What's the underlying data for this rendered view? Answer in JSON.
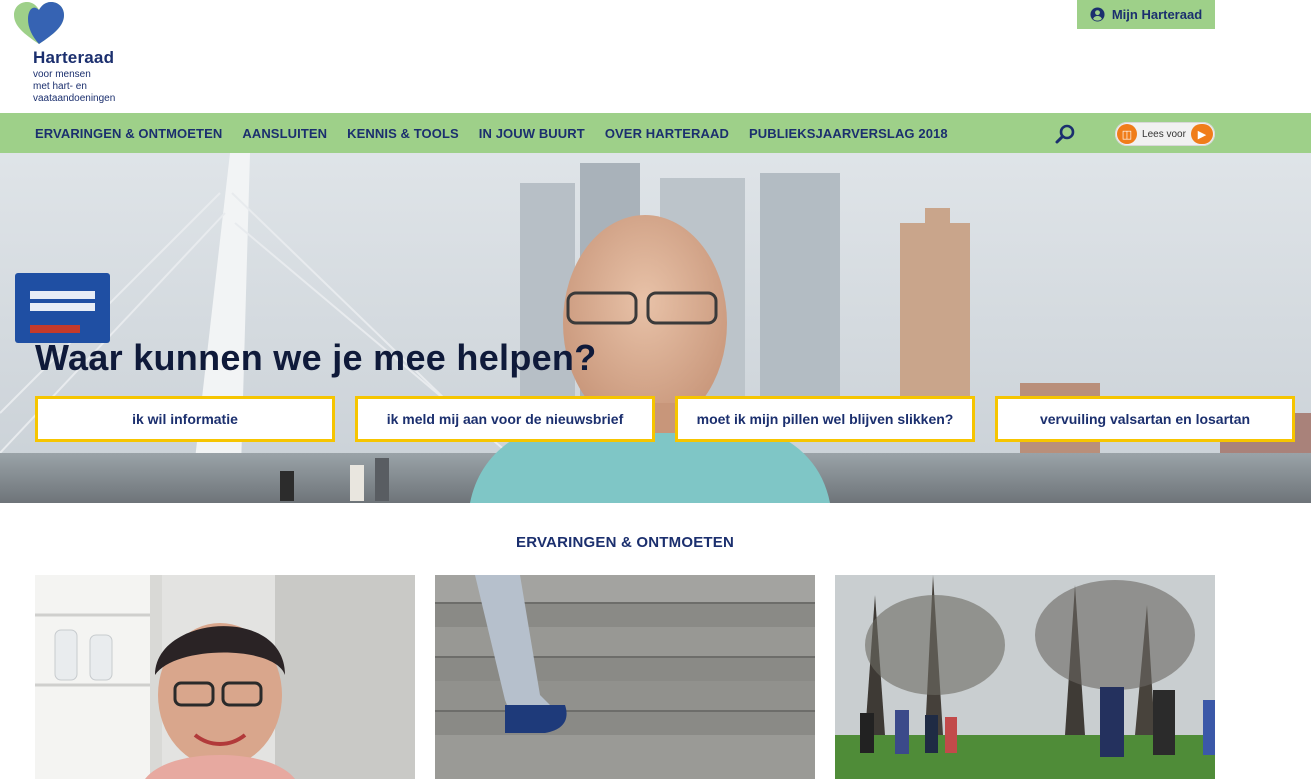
{
  "brand": {
    "name": "Harteraad",
    "tagline": [
      "voor mensen",
      "met hart- en",
      "vaataandoeningen"
    ]
  },
  "account": {
    "label": "Mijn Harteraad",
    "icon": "user-circle-icon"
  },
  "nav": {
    "items": [
      "ERVARINGEN & ONTMOETEN",
      "AANSLUITEN",
      "KENNIS & TOOLS",
      "IN JOUW BUURT",
      "OVER HARTERAAD",
      "PUBLIEKSJAARVERSLAG 2018"
    ],
    "search_icon": "search-icon",
    "read_aloud": {
      "label": "Lees voor",
      "icon": "ear-icon",
      "play_icon": "play-icon"
    }
  },
  "hero": {
    "title": "Waar kunnen we je mee helpen?",
    "buttons": [
      "ik wil informatie",
      "ik meld mij aan voor de nieuwsbrief",
      "moet ik mijn pillen wel blijven slikken?",
      "vervuiling valsartan en losartan"
    ]
  },
  "section": {
    "title": "ERVARINGEN & ONTMOETEN"
  },
  "colors": {
    "brand_green": "#9ed089",
    "brand_navy": "#1b2f6e",
    "accent_yellow": "#f6c500",
    "read_aloud_orange": "#f07d1a"
  }
}
